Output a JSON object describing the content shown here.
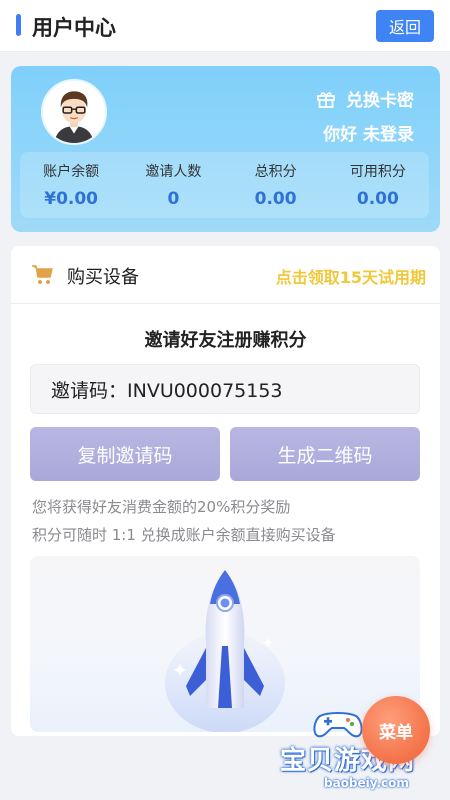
{
  "header": {
    "title": "用户中心",
    "back_label": "返回"
  },
  "profile": {
    "redeem_label": "兑换卡密",
    "greeting": "你好 未登录",
    "stats": [
      {
        "label": "账户余额",
        "value": "¥0.00"
      },
      {
        "label": "邀请人数",
        "value": "0"
      },
      {
        "label": "总积分",
        "value": "0.00"
      },
      {
        "label": "可用积分",
        "value": "0.00"
      }
    ]
  },
  "purchase": {
    "title": "购买设备",
    "trial_link": "点击领取15天试用期",
    "invite_heading": "邀请好友注册赚积分",
    "invite_code": "邀请码：INVU000075153",
    "copy_button": "复制邀请码",
    "qr_button": "生成二维码",
    "note_1": "您将获得好友消费金额的20%积分奖励",
    "note_2": "积分可随时 1:1 兑换成账户余额直接购买设备"
  },
  "menu_fab": {
    "label": "菜单"
  },
  "watermark": {
    "text": "宝贝游戏网",
    "url": "baobeiy.com"
  },
  "colors": {
    "accent": "#3f84f5",
    "trial": "#f0c83a",
    "fab": "#f37249"
  },
  "icons": [
    "gift-icon",
    "cart-icon",
    "avatar-illustration",
    "rocket-illustration",
    "gamepad-icon"
  ]
}
